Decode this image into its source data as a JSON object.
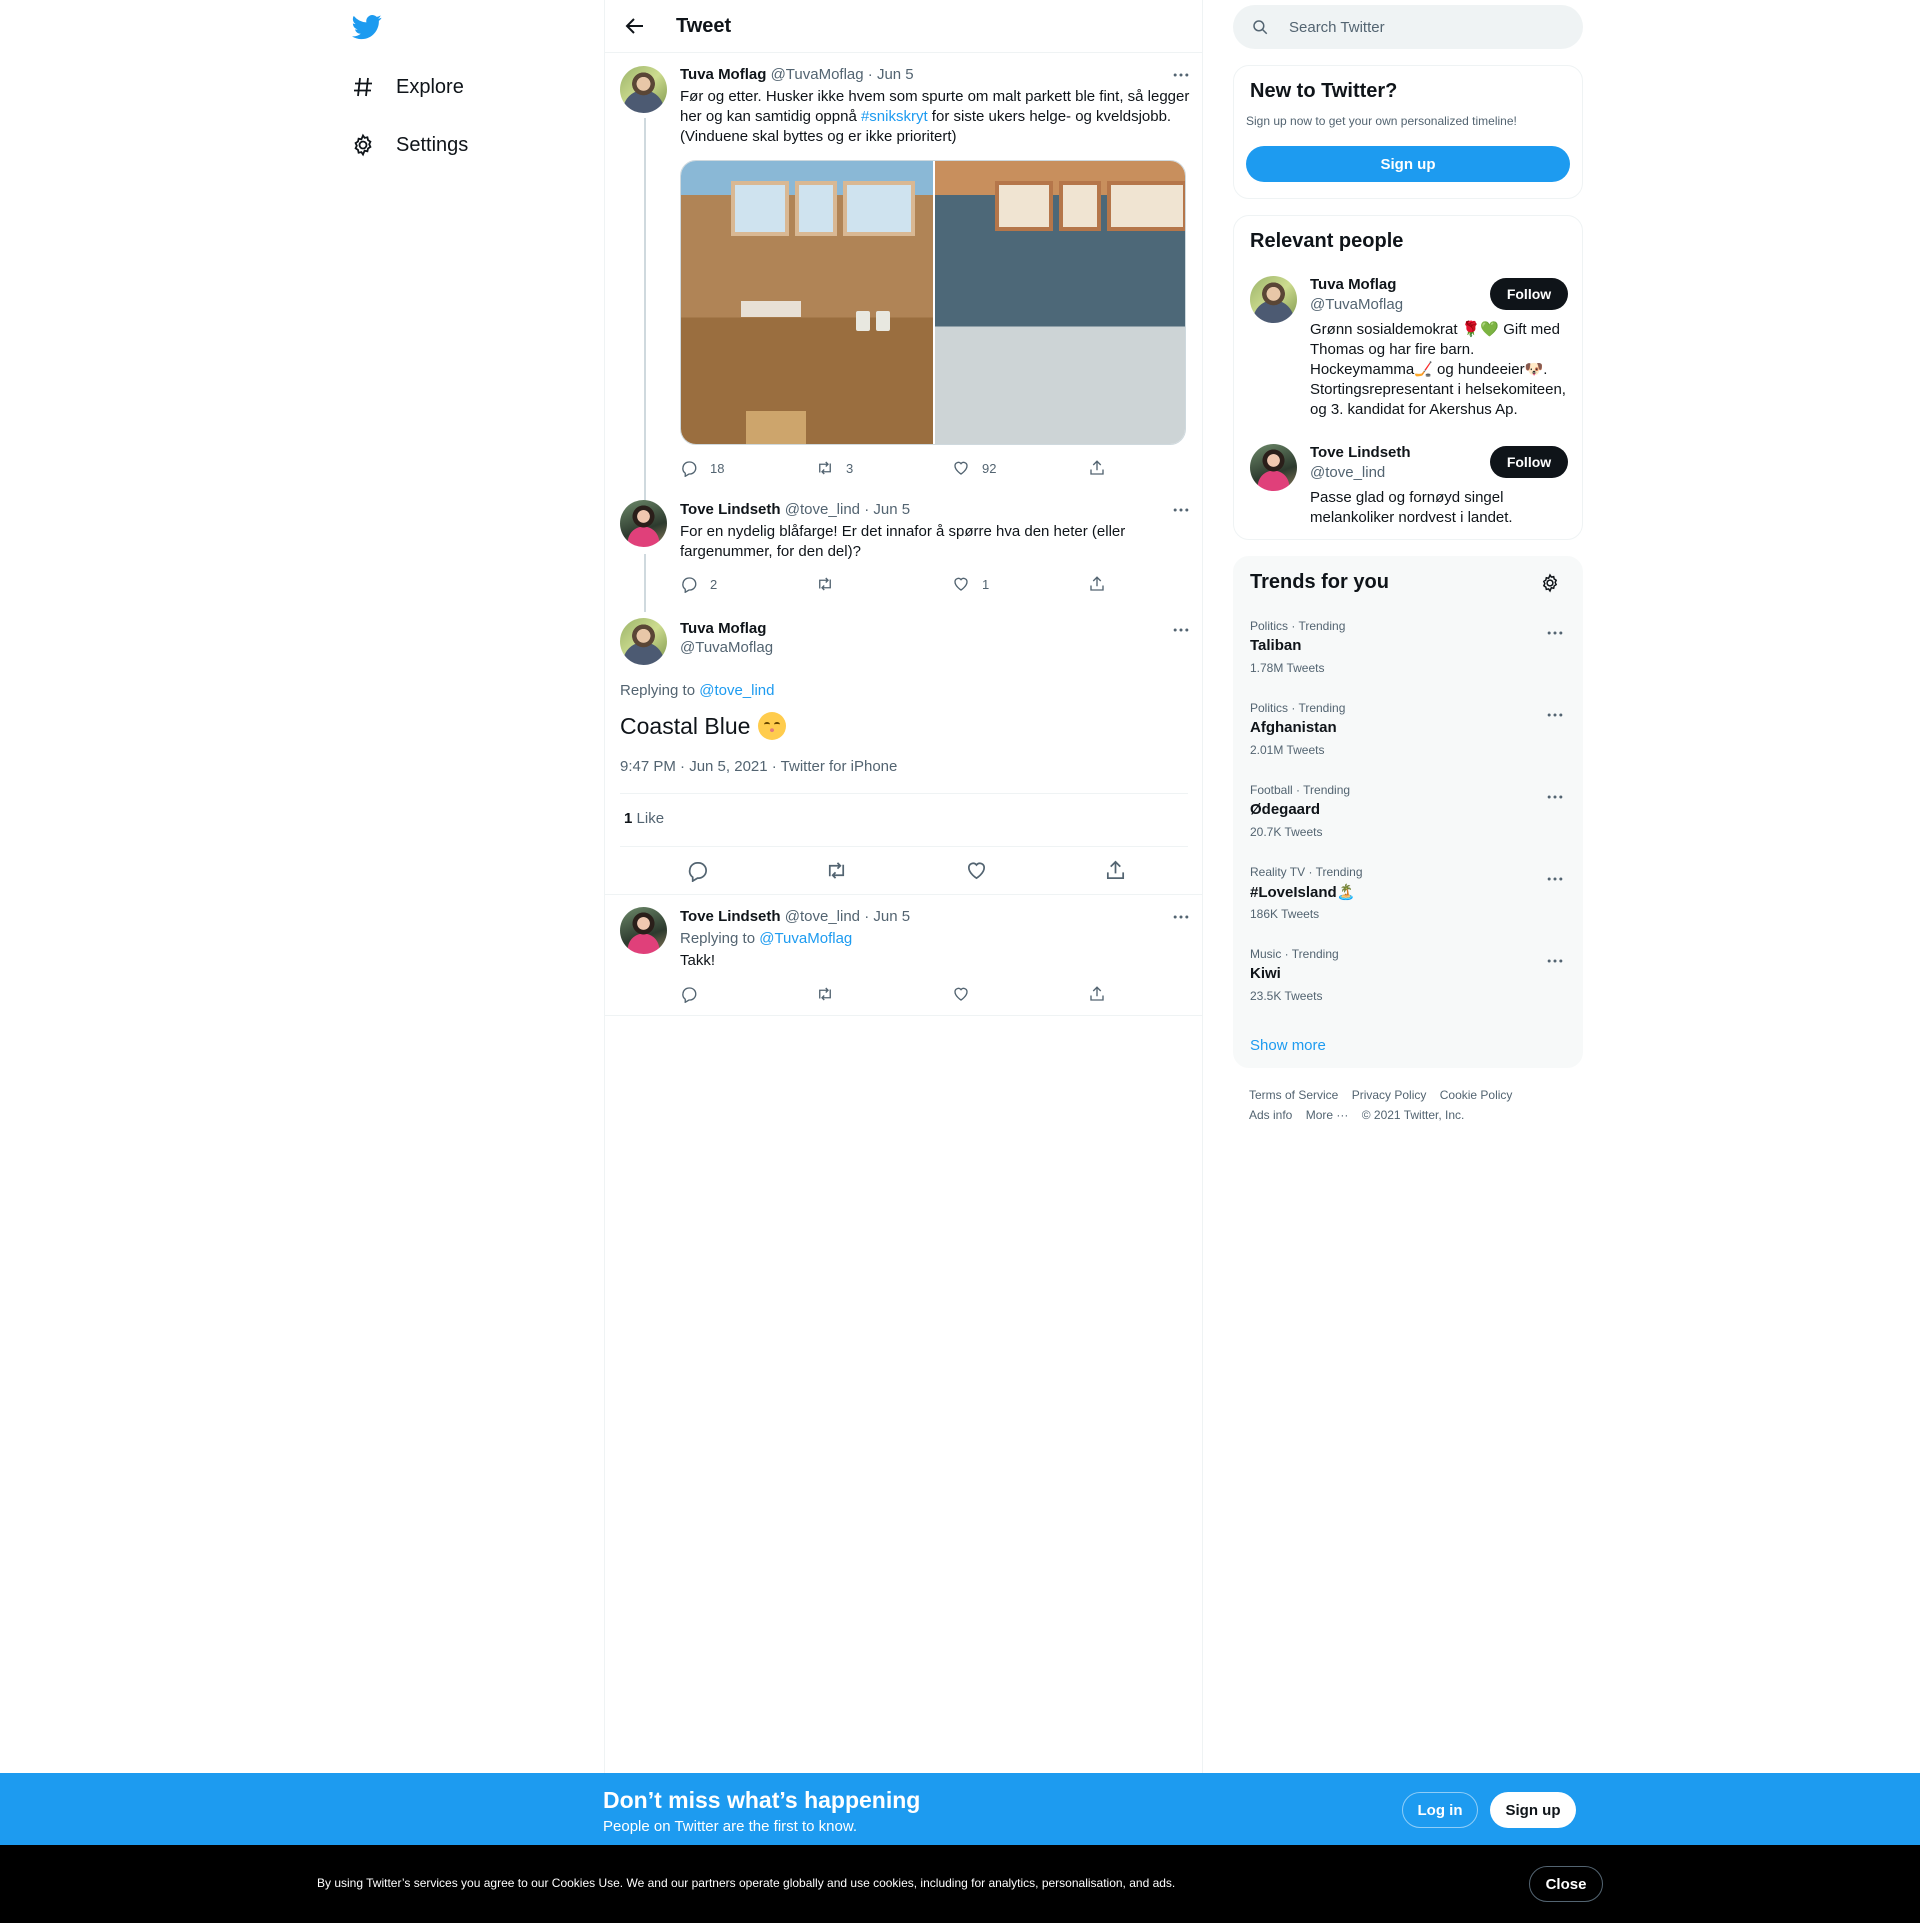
{
  "nav": {
    "explore": "Explore",
    "settings": "Settings"
  },
  "header": {
    "title": "Tweet"
  },
  "tweets": [
    {
      "name": "Tuva Moflag",
      "handle": "@TuvaMoflag",
      "date": "· Jun 5",
      "text_before": "Før og etter. Husker ikke hvem som spurte om malt parkett ble fint, så legger her og kan samtidig oppnå ",
      "hashtag": "#snikskryt",
      "text_after": " for siste ukers helge- og kveldsjobb. (Vinduene skal byttes og er ikke prioritert)",
      "replies": "18",
      "retweets": "3",
      "likes": "92"
    },
    {
      "name": "Tove Lindseth",
      "handle": "@tove_lind",
      "date": "· Jun 5",
      "text": "For en nydelig blåfarge! Er det innafor å spørre hva den heter (eller fargenummer, for den del)?",
      "replies": "2",
      "retweets": "",
      "likes": "1"
    }
  ],
  "focused": {
    "name": "Tuva Moflag",
    "handle": "@TuvaMoflag",
    "replying_prefix": "Replying to ",
    "replying_to": "@tove_lind",
    "text": "Coastal Blue",
    "meta": "9:47 PM · Jun 5, 2021 · Twitter for iPhone",
    "like_count": "1",
    "like_label": "Like"
  },
  "reply": {
    "name": "Tove Lindseth",
    "handle": "@tove_lind",
    "date": "· Jun 5",
    "replying_prefix": "Replying to ",
    "replying_to": "@TuvaMoflag",
    "text": "Takk!"
  },
  "search": {
    "placeholder": "Search Twitter"
  },
  "new_to_twitter": {
    "title": "New to Twitter?",
    "subtitle": "Sign up now to get your own personalized timeline!",
    "button": "Sign up"
  },
  "relevant_people": {
    "title": "Relevant people",
    "follow": "Follow",
    "people": [
      {
        "name": "Tuva Moflag",
        "handle": "@TuvaMoflag",
        "bio": "Grønn sosialdemokrat 🌹💚 Gift med Thomas og har fire barn. Hockeymamma🏒 og hundeeier🐶. Stortingsrepresentant i helsekomiteen, og 3. kandidat for Akershus Ap."
      },
      {
        "name": "Tove Lindseth",
        "handle": "@tove_lind",
        "bio": "Passe glad og fornøyd singel melankoliker nordvest i landet."
      }
    ]
  },
  "trends": {
    "title": "Trends for you",
    "items": [
      {
        "category": "Politics · Trending",
        "name": "Taliban",
        "count": "1.78M Tweets"
      },
      {
        "category": "Politics · Trending",
        "name": "Afghanistan",
        "count": "2.01M Tweets"
      },
      {
        "category": "Football · Trending",
        "name": "Ødegaard",
        "count": "20.7K Tweets"
      },
      {
        "category": "Reality TV · Trending",
        "name": "#LoveIsland🏝️",
        "count": "186K Tweets"
      },
      {
        "category": "Music · Trending",
        "name": "Kiwi",
        "count": "23.5K Tweets"
      }
    ],
    "show_more": "Show more"
  },
  "footer": {
    "terms": "Terms of Service",
    "privacy": "Privacy Policy",
    "cookie": "Cookie Policy",
    "ads": "Ads info",
    "more": "More ···",
    "copyright": "© 2021 Twitter, Inc."
  },
  "banner": {
    "title": "Don’t miss what’s happening",
    "subtitle": "People on Twitter are the first to know.",
    "login": "Log in",
    "signup": "Sign up"
  },
  "cookie_bar": {
    "text": "By using Twitter’s services you agree to our Cookies Use. We and our partners operate globally and use cookies, including for analytics, personalisation, and ads.",
    "close": "Close"
  },
  "colors": {
    "accent": "#1d9bf0",
    "text": "#0f1419",
    "secondary": "#536471",
    "border": "#eff3f4",
    "cookie_bg": "#000000"
  }
}
